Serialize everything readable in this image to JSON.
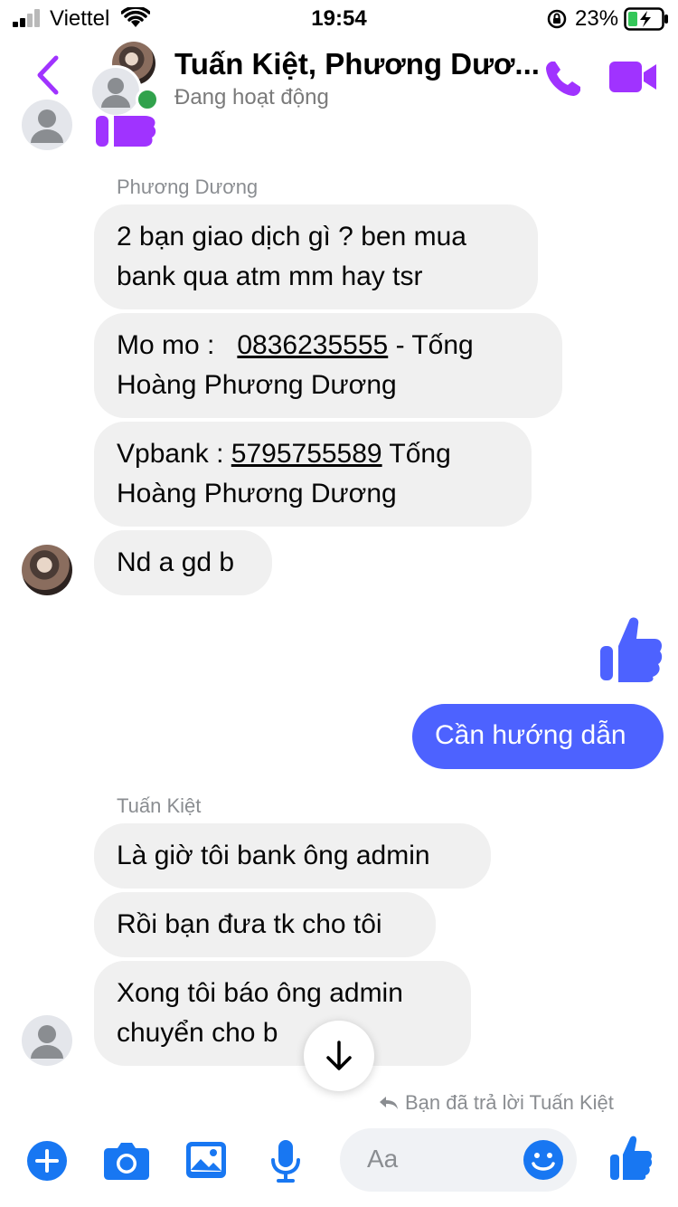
{
  "status_bar": {
    "carrier": "Viettel",
    "time": "19:54",
    "battery": "23%"
  },
  "header": {
    "title": "Tuấn Kiệt, Phương Dươ...",
    "subtitle": "Đang hoạt động"
  },
  "messages": {
    "sender_phuong": "Phương Dương",
    "msg1_line1": "2 bạn giao dịch gì ? ben mua",
    "msg1_line2": "bank qua atm mm hay tsr",
    "msg2_prefix": "Mo mo :",
    "msg2_phone": "0836235555",
    "msg2_suffix": " - Tống",
    "msg2_line2": "Hoàng Phương Dương",
    "msg3_prefix": "Vpbank :",
    "msg3_account": "5795755589",
    "msg3_suffix": " Tống",
    "msg3_line2": "Hoàng Phương Dương",
    "msg4": "Nd a gd b",
    "outgoing": "Cần hướng dẫn",
    "sender_tuan": "Tuấn Kiệt",
    "msg5": "Là giờ tôi bank ông admin",
    "msg6": "Rồi bạn đưa tk cho tôi",
    "msg7_line1": "Xong tôi báo ông admin",
    "msg7_line2": "chuyển cho b"
  },
  "reply_note": "Bạn đã trả lời Tuấn Kiệt",
  "composer": {
    "placeholder": "Aa"
  },
  "colors": {
    "accent_purple": "#a033ff",
    "outgoing_blue": "#4d62ff",
    "composer_blue": "#1877f2",
    "bubble_gray": "#f0f0f0"
  }
}
